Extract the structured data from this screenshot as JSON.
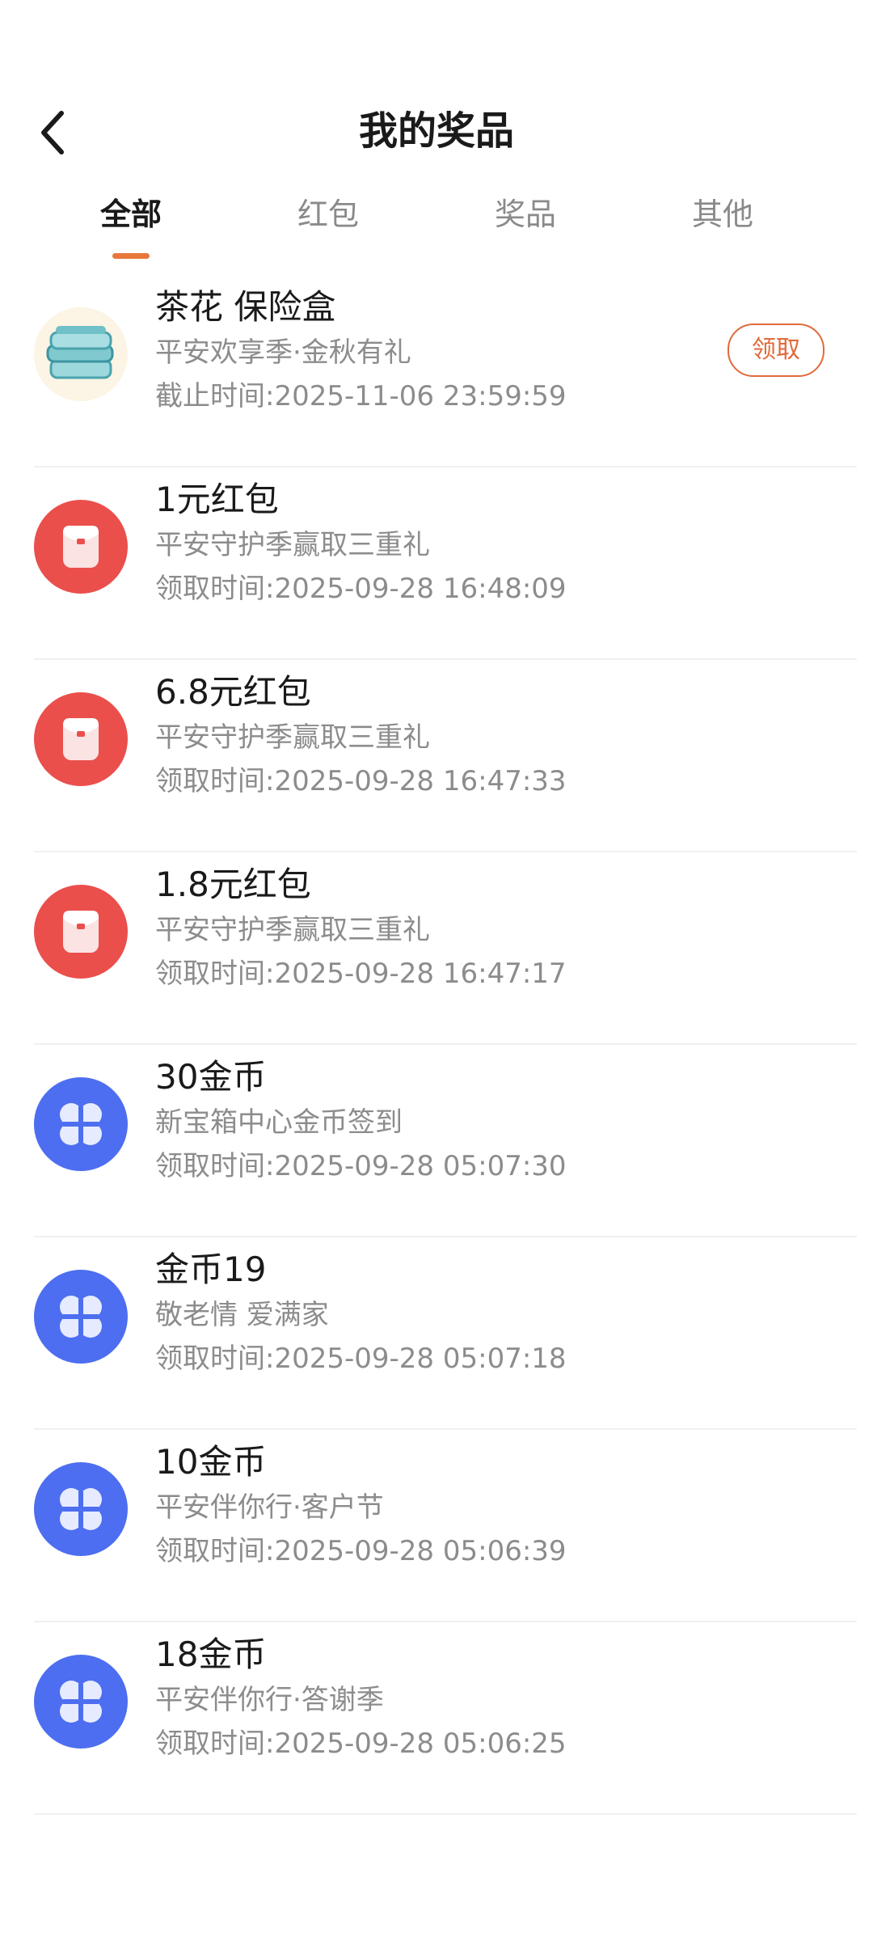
{
  "header": {
    "title": "我的奖品",
    "back_icon": "chevron-left-icon"
  },
  "tabs": [
    {
      "label": "全部",
      "active": true
    },
    {
      "label": "红包",
      "active": false
    },
    {
      "label": "奖品",
      "active": false
    },
    {
      "label": "其他",
      "active": false
    }
  ],
  "colors": {
    "accent": "#e8773a",
    "claim": "#e06a3a",
    "red_envelope": "#ea4f4c",
    "coin": "#4d6ef0",
    "subtext": "#8c8c8c"
  },
  "items": [
    {
      "icon": "storage-box-icon",
      "title": "茶花 保险盒",
      "subtitle": "平安欢享季·金秋有礼",
      "time": "截止时间:2025-11-06 23:59:59",
      "action": "领取"
    },
    {
      "icon": "red-envelope-icon",
      "title": "1元红包",
      "subtitle": "平安守护季赢取三重礼",
      "time": "领取时间:2025-09-28 16:48:09"
    },
    {
      "icon": "red-envelope-icon",
      "title": "6.8元红包",
      "subtitle": "平安守护季赢取三重礼",
      "time": "领取时间:2025-09-28 16:47:33"
    },
    {
      "icon": "red-envelope-icon",
      "title": "1.8元红包",
      "subtitle": "平安守护季赢取三重礼",
      "time": "领取时间:2025-09-28 16:47:17"
    },
    {
      "icon": "coin-icon",
      "title": "30金币",
      "subtitle": "新宝箱中心金币签到",
      "time": "领取时间:2025-09-28 05:07:30"
    },
    {
      "icon": "coin-icon",
      "title": "金币19",
      "subtitle": "敬老情 爱满家",
      "time": "领取时间:2025-09-28 05:07:18"
    },
    {
      "icon": "coin-icon",
      "title": "10金币",
      "subtitle": "平安伴你行·客户节",
      "time": "领取时间:2025-09-28 05:06:39"
    },
    {
      "icon": "coin-icon",
      "title": "18金币",
      "subtitle": "平安伴你行·答谢季",
      "time": "领取时间:2025-09-28 05:06:25"
    }
  ]
}
